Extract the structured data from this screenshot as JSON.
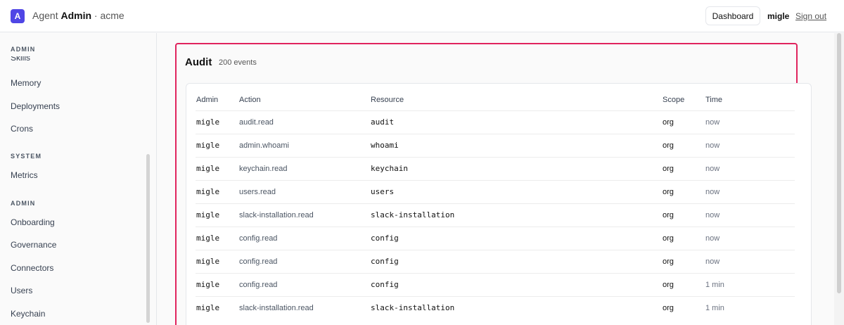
{
  "header": {
    "logo_letter": "A",
    "brand_prefix": "Agent ",
    "brand_bold": "Admin",
    "brand_suffix": " · acme",
    "dashboard_label": "Dashboard",
    "user": "migle",
    "signout_label": "Sign out"
  },
  "sidebar": {
    "section_admin_top": "ADMIN",
    "item_skills": "Skills",
    "item_memory": "Memory",
    "item_deployments": "Deployments",
    "item_crons": "Crons",
    "section_system": "SYSTEM",
    "item_metrics": "Metrics",
    "section_admin": "ADMIN",
    "item_onboarding": "Onboarding",
    "item_governance": "Governance",
    "item_connectors": "Connectors",
    "item_users": "Users",
    "item_keychain": "Keychain"
  },
  "audit": {
    "title": "Audit",
    "count": "200 events",
    "columns": {
      "admin": "Admin",
      "action": "Action",
      "resource": "Resource",
      "scope": "Scope",
      "time": "Time"
    },
    "rows": [
      {
        "admin": "migle",
        "action": "audit.read",
        "resource": "audit",
        "scope": "org",
        "time": "now"
      },
      {
        "admin": "migle",
        "action": "admin.whoami",
        "resource": "whoami",
        "scope": "org",
        "time": "now"
      },
      {
        "admin": "migle",
        "action": "keychain.read",
        "resource": "keychain",
        "scope": "org",
        "time": "now"
      },
      {
        "admin": "migle",
        "action": "users.read",
        "resource": "users",
        "scope": "org",
        "time": "now"
      },
      {
        "admin": "migle",
        "action": "slack-installation.read",
        "resource": "slack-installation",
        "scope": "org",
        "time": "now"
      },
      {
        "admin": "migle",
        "action": "config.read",
        "resource": "config",
        "scope": "org",
        "time": "now"
      },
      {
        "admin": "migle",
        "action": "config.read",
        "resource": "config",
        "scope": "org",
        "time": "now"
      },
      {
        "admin": "migle",
        "action": "config.read",
        "resource": "config",
        "scope": "org",
        "time": "1 min"
      },
      {
        "admin": "migle",
        "action": "slack-installation.read",
        "resource": "slack-installation",
        "scope": "org",
        "time": "1 min"
      }
    ]
  }
}
